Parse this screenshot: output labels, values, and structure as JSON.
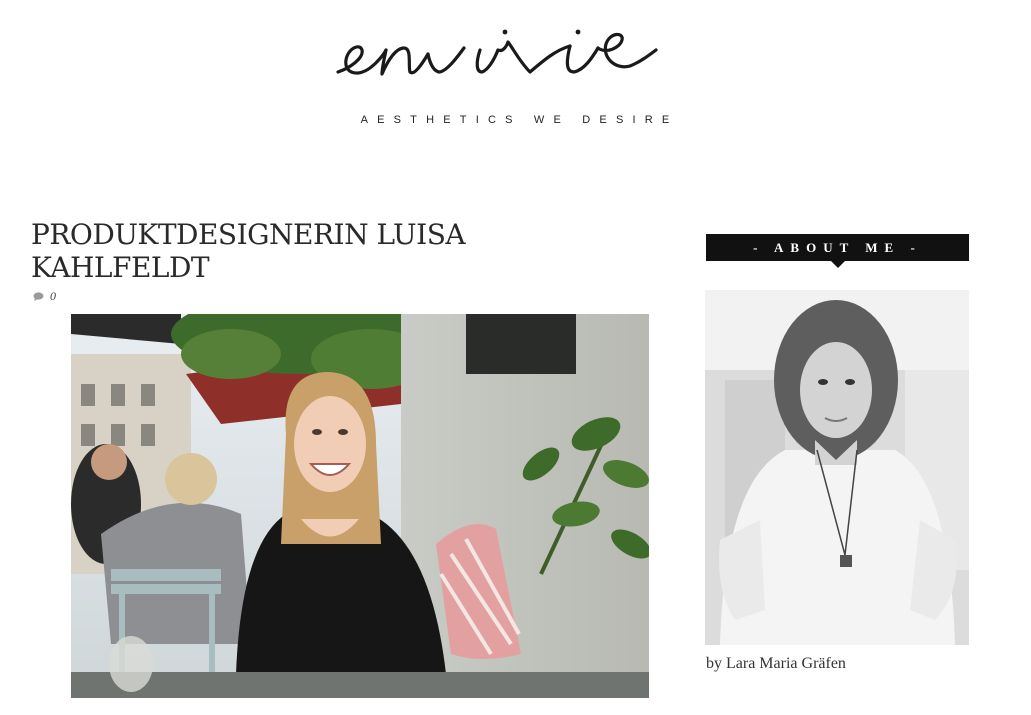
{
  "site": {
    "logo_text": "envie",
    "tagline": "AESTHETICS WE DESIRE"
  },
  "post": {
    "title": "PRODUKTDESIGNERIN LUISA KAHLFELDT",
    "comment_count": "0",
    "image_alt": "Luisa Kahlfeldt smiling at an outdoor cafe table"
  },
  "sidebar": {
    "widget_title": "- ABOUT ME -",
    "author_caption": "by Lara Maria Gräfen"
  },
  "colors": {
    "bar_bg": "#111111",
    "text": "#222222"
  },
  "icons": {
    "comment": "speech-bubble-icon"
  }
}
